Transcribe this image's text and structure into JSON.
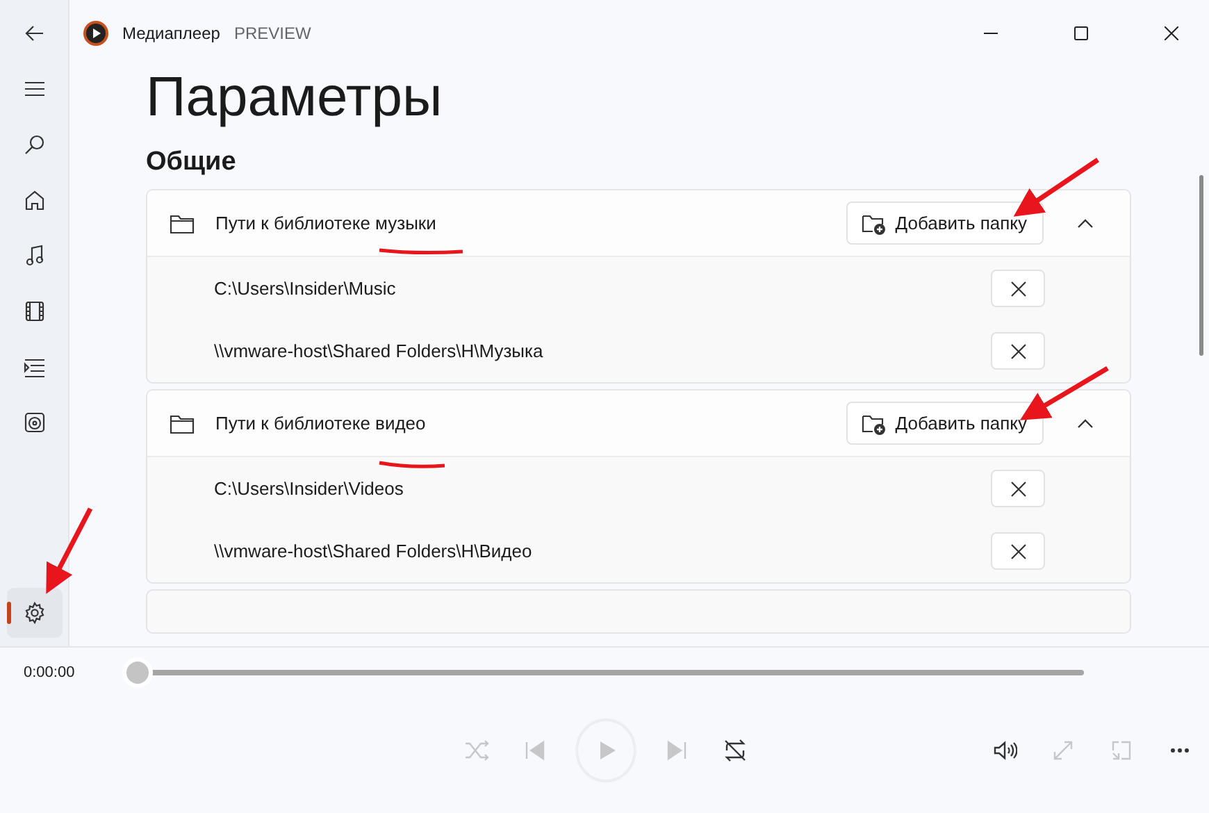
{
  "app": {
    "title": "Медиаплеер",
    "badge": "PREVIEW"
  },
  "nav": [
    {
      "kind": "back",
      "selected": false
    },
    {
      "kind": "menu",
      "selected": false
    },
    {
      "kind": "search",
      "selected": false
    },
    {
      "kind": "home",
      "selected": false
    },
    {
      "kind": "music",
      "selected": false
    },
    {
      "kind": "video",
      "selected": false
    },
    {
      "kind": "queue",
      "selected": false
    },
    {
      "kind": "playlists",
      "selected": false
    },
    {
      "kind": "settings",
      "selected": true
    }
  ],
  "page_title": "Параметры",
  "section": "Общие",
  "libraries": [
    {
      "title": "Пути к библиотеке музыки",
      "button": "Добавить папку",
      "expanded": true,
      "paths": [
        "C:\\Users\\Insider\\Music",
        "\\\\vmware-host\\Shared Folders\\H\\Музыка"
      ]
    },
    {
      "title": "Пути к библиотеке видео",
      "button": "Добавить папку",
      "expanded": true,
      "paths": [
        "C:\\Users\\Insider\\Videos",
        "\\\\vmware-host\\Shared Folders\\H\\Видео"
      ]
    }
  ],
  "player": {
    "time": "0:00:00",
    "seek": {
      "level": 0
    },
    "controls": [
      {
        "kind": "shuffle",
        "disabled": true
      },
      {
        "kind": "previous",
        "disabled": true
      },
      {
        "kind": "play",
        "disabled": true
      },
      {
        "kind": "next",
        "disabled": true
      },
      {
        "kind": "repeat",
        "disabled": false
      },
      {
        "kind": "volume",
        "disabled": false
      },
      {
        "kind": "fullscreen",
        "disabled": true
      },
      {
        "kind": "miniplayer",
        "disabled": true
      },
      {
        "kind": "more",
        "disabled": false
      }
    ]
  }
}
